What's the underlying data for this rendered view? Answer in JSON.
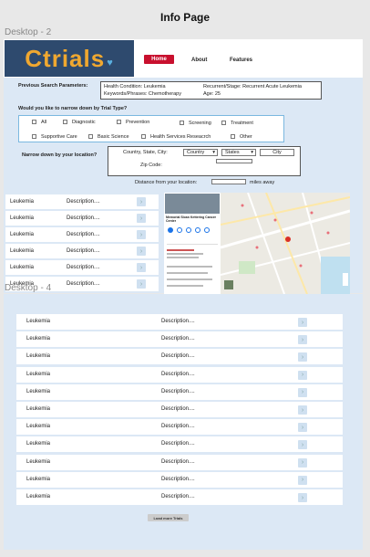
{
  "page_title": "Info Page",
  "frame1_label": "Desktop - 2",
  "frame2_label": "Desktop - 4",
  "logo_text": "Ctrials",
  "nav": {
    "home": "Home",
    "about": "About",
    "features": "Features"
  },
  "prev_search": {
    "label": "Previous Search Parameters:",
    "condition": "Health Condition: Leukemia",
    "keywords": "Keywords/Phrases: Chemotherapy",
    "stage": "Recurrent/Stage: Recurrent Acute Leukemia",
    "age": "Age: 25"
  },
  "trial_type": {
    "question": "Would you like to narrow down by Trial Type?",
    "options": [
      "All",
      "Diagnostic",
      "Prevention",
      "Screening",
      "Treatment",
      "Supportive Care",
      "Basic Science",
      "Health Services Reseacrch",
      "Other"
    ]
  },
  "location": {
    "question": "Narrow down by your location?",
    "country_state_city_label": "Country, State, City:",
    "country_value": "Country",
    "states_value": "States",
    "city_placeholder": "City",
    "zip_label": "Zip Code:",
    "distance_label": "Distance from your location:",
    "distance_unit": "miles away"
  },
  "results_frame1": [
    {
      "name": "Leukemia",
      "desc": "Description...."
    },
    {
      "name": "Leukemia",
      "desc": "Description...."
    },
    {
      "name": "Leukemia",
      "desc": "Description...."
    },
    {
      "name": "Leukemia",
      "desc": "Description...."
    },
    {
      "name": "Leukemia",
      "desc": "Description...."
    },
    {
      "name": "Leukemia",
      "desc": "Description...."
    }
  ],
  "map": {
    "place_title": "Memorial Sloan Kettering Cancer Center"
  },
  "results_frame2": [
    {
      "name": "Leukemia",
      "desc": "Description...."
    },
    {
      "name": "Leukemia",
      "desc": "Description...."
    },
    {
      "name": "Leukemia",
      "desc": "Description...."
    },
    {
      "name": "Leukemia",
      "desc": "Description...."
    },
    {
      "name": "Leukemia",
      "desc": "Description...."
    },
    {
      "name": "Leukemia",
      "desc": "Description...."
    },
    {
      "name": "Leukemia",
      "desc": "Description...."
    },
    {
      "name": "Leukemia",
      "desc": "Description...."
    },
    {
      "name": "Leukemia",
      "desc": "Description...."
    },
    {
      "name": "Leukemia",
      "desc": "Description...."
    },
    {
      "name": "Leukemia",
      "desc": "Description...."
    }
  ],
  "load_more": "Load more Trials",
  "colors": {
    "brand_red": "#c8102e",
    "logo_bg": "#2e4a6e",
    "logo_text": "#f0a830",
    "frame_bg": "#dce8f5"
  }
}
